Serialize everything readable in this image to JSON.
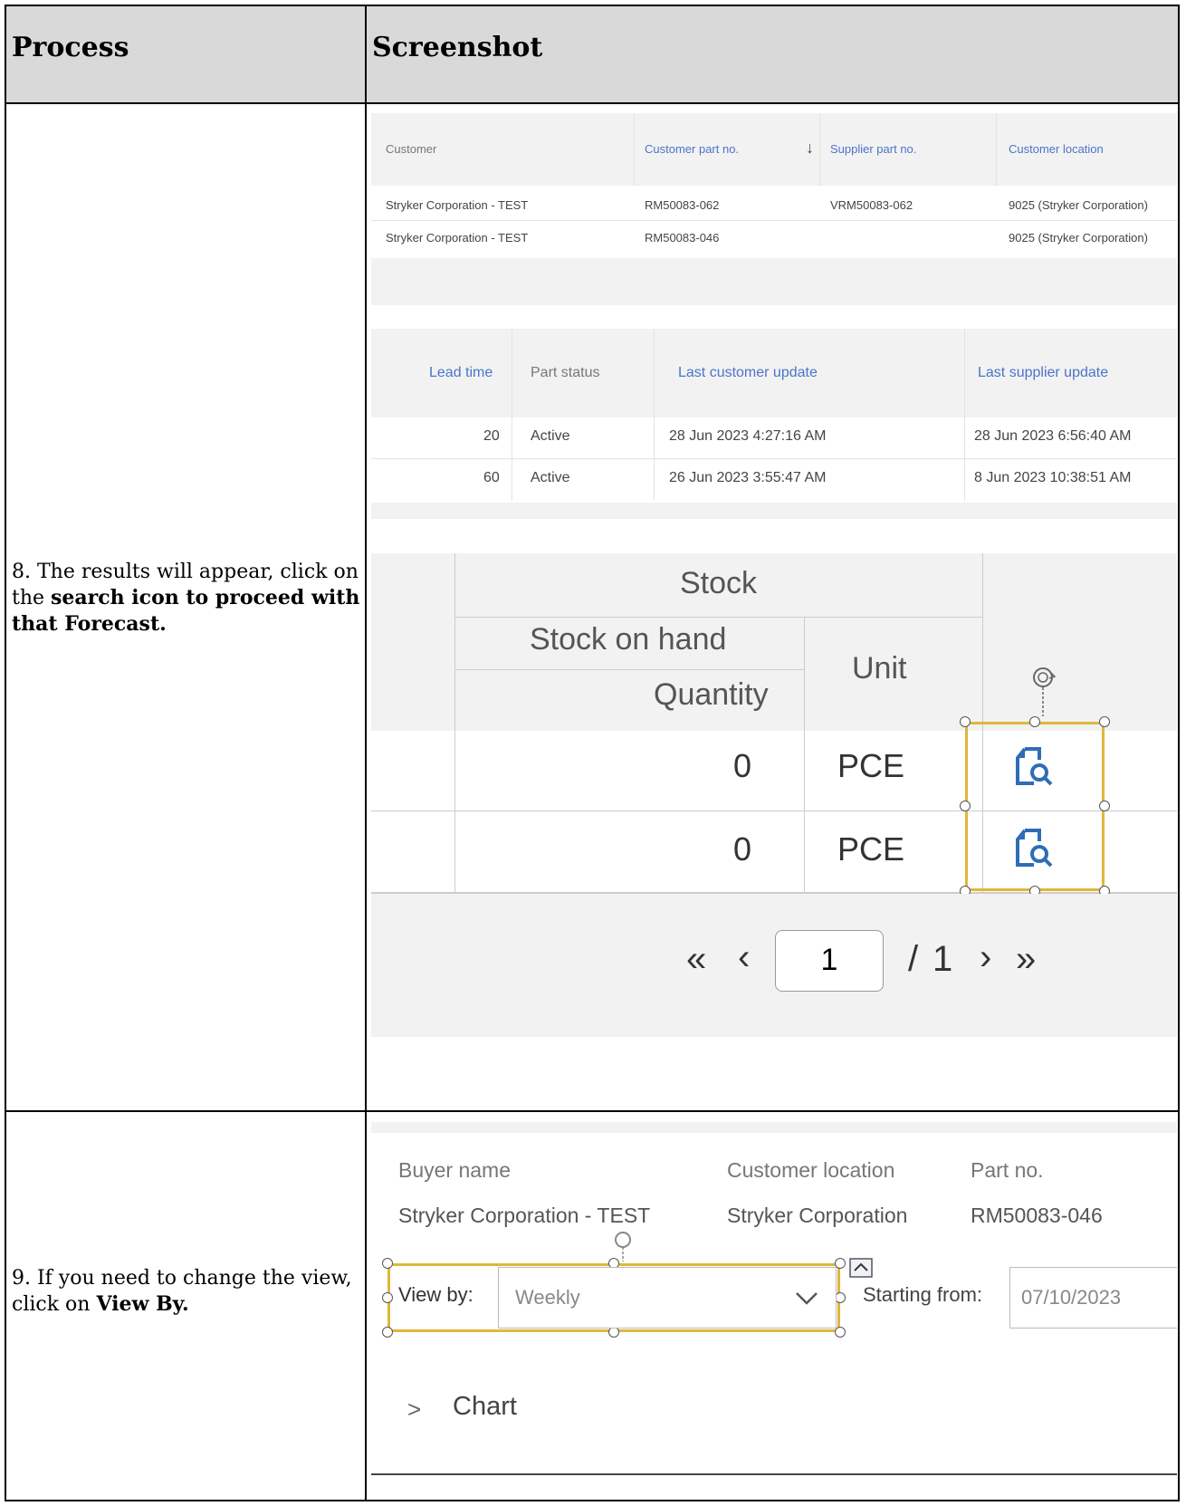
{
  "header": {
    "process": "Process",
    "screenshot": "Screenshot"
  },
  "step8": {
    "text_before": "8. The results will appear, click on the ",
    "text_bold": "search icon to proceed with that Forecast.",
    "top_table": {
      "headers": [
        "Customer",
        "Customer part no.",
        "Supplier part no.",
        "Customer location"
      ],
      "rows": [
        [
          "Stryker Corporation - TEST",
          "RM50083-062",
          "VRM50083-062",
          "9025 (Stryker Corporation)"
        ],
        [
          "Stryker Corporation - TEST",
          "RM50083-046",
          "",
          "9025 (Stryker Corporation)"
        ]
      ]
    },
    "mid_table": {
      "headers": [
        "Lead time",
        "Part status",
        "Last customer update",
        "Last supplier update"
      ],
      "rows": [
        [
          "20",
          "Active",
          "28 Jun 2023 4:27:16 AM",
          "28 Jun 2023 6:56:40 AM"
        ],
        [
          "60",
          "Active",
          "26 Jun 2023 3:55:47 AM",
          "8 Jun 2023 10:38:51 AM"
        ]
      ]
    },
    "stock_table": {
      "group_header": "Stock",
      "sub_header": "Stock on hand",
      "quantity_header": "Quantity",
      "unit_header": "Unit",
      "rows": [
        {
          "quantity": "0",
          "unit": "PCE"
        },
        {
          "quantity": "0",
          "unit": "PCE"
        }
      ]
    },
    "pager": {
      "first": "«",
      "prev": "‹",
      "page": "1",
      "of_label": "/",
      "total": "1",
      "next": "›",
      "last": "»"
    }
  },
  "step9": {
    "text_before": "9. If you need to change the view, click on ",
    "text_bold": "View By.",
    "fields": {
      "buyer_label": "Buyer name",
      "buyer_value": "Stryker Corporation - TEST",
      "location_label": "Customer location",
      "location_value": "Stryker Corporation",
      "part_label": "Part no.",
      "part_value": "RM50083-046"
    },
    "view_by_label": "View by:",
    "view_by_value": "Weekly",
    "starting_from_label": "Starting from:",
    "starting_from_value": "07/10/2023",
    "chart_label": "Chart"
  },
  "colors": {
    "selection": "#e0b73a",
    "link_blue": "#4a74c9",
    "icon_blue": "#2f6db5"
  }
}
